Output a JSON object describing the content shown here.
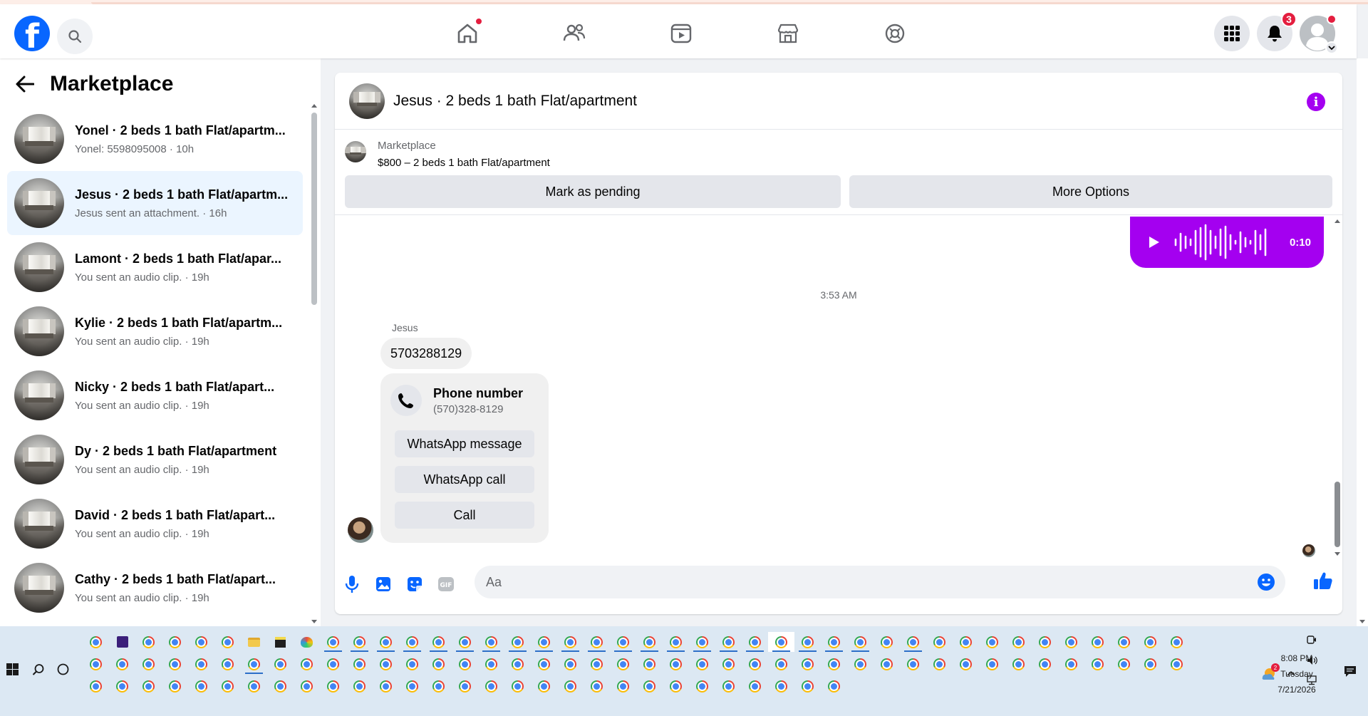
{
  "nav": {
    "logo": "f",
    "notifications_count": "3"
  },
  "sidebar": {
    "title": "Marketplace",
    "items": [
      {
        "title": "Yonel · 2 beds 1 bath Flat/apartm...",
        "sub": "Yonel: 5598095008 · 10h"
      },
      {
        "title": "Jesus · 2 beds 1 bath Flat/apartm...",
        "sub": "Jesus sent an attachment. · 16h"
      },
      {
        "title": "Lamont · 2 beds 1 bath Flat/apar...",
        "sub": "You sent an audio clip. · 19h"
      },
      {
        "title": "Kylie · 2 beds 1 bath Flat/apartm...",
        "sub": "You sent an audio clip. · 19h"
      },
      {
        "title": "Nicky · 2 beds 1 bath Flat/apart...",
        "sub": "You sent an audio clip. · 19h"
      },
      {
        "title": "Dy · 2 beds 1 bath Flat/apartment",
        "sub": "You sent an audio clip. · 19h"
      },
      {
        "title": "David · 2 beds 1 bath Flat/apart...",
        "sub": "You sent an audio clip. · 19h"
      },
      {
        "title": "Cathy · 2 beds 1 bath Flat/apart...",
        "sub": "You sent an audio clip. · 19h"
      }
    ]
  },
  "chat": {
    "title": "Jesus · 2 beds 1 bath Flat/apartment",
    "listing_category": "Marketplace",
    "listing_price": "$800 – 2 beds 1 bath Flat/apartment",
    "mark_pending_label": "Mark as pending",
    "more_options_label": "More Options",
    "audio_duration": "0:10",
    "timestamp": "3:53 AM",
    "sender_name": "Jesus",
    "message_text": "5703288129",
    "phone_card": {
      "title": "Phone number",
      "number": "(570)328-8129",
      "whatsapp_message": "WhatsApp message",
      "whatsapp_call": "WhatsApp call",
      "call": "Call"
    },
    "composer_placeholder": "Aa"
  },
  "taskbar": {
    "time": "8:08 PM",
    "day": "Tuesday",
    "date": "7/21/2026",
    "tray_badge": "2"
  },
  "colors": {
    "facebook_blue": "#0866ff",
    "messenger_purple": "#a400f0",
    "badge_red": "#e41e3f"
  }
}
